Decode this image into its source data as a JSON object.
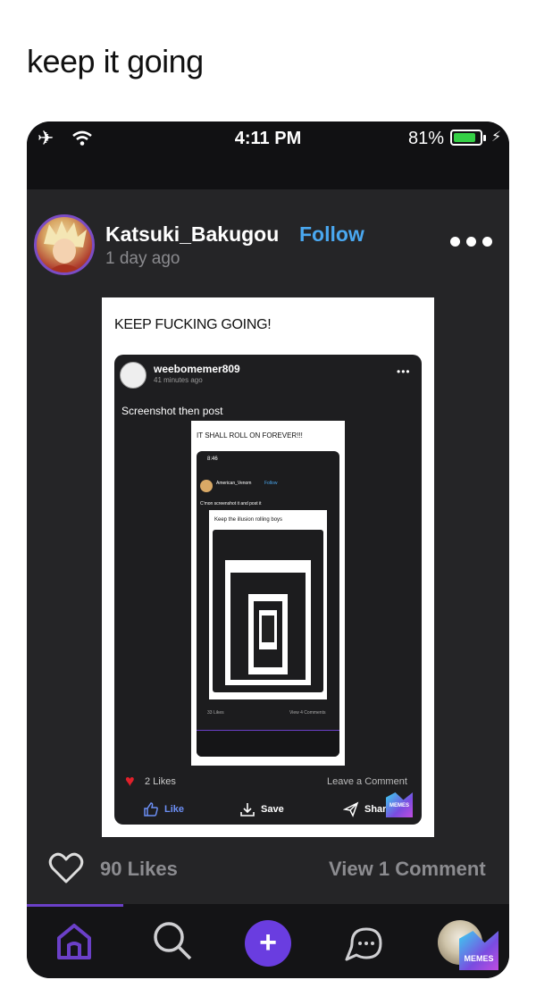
{
  "caption": "keep it going",
  "status_bar": {
    "time": "4:11 PM",
    "battery": "81%"
  },
  "post": {
    "username": "Katsuki_Bakugou",
    "follow_label": "Follow",
    "time_ago": "1 day ago",
    "image_title": "KEEP FUCKING GOING!"
  },
  "embedded_post": {
    "username": "weebomemer809",
    "time_ago": "41 minutes ago",
    "text": "Screenshot then post",
    "image_title": "IT SHALL ROLL ON FOREVER!!!",
    "likes": "2 Likes",
    "leave_comment": "Leave a Comment",
    "like_label": "Like",
    "save_label": "Save",
    "share_label": "Share",
    "nested": {
      "time": "8:46",
      "username": "American_Venom",
      "follow_label": "Follow",
      "text": "C'mon screenshot it and post it",
      "image_title": "Keep the illusion rolling boys",
      "likes": "33 Likes",
      "comments": "View 4 Comments"
    }
  },
  "footer": {
    "likes": "90 Likes",
    "comments": "View 1 Comment"
  },
  "watermark": "MEMES",
  "icons": [
    "airplane-icon",
    "wifi-icon",
    "battery-icon",
    "heart-icon",
    "home-icon",
    "search-icon",
    "plus-icon",
    "chat-icon"
  ],
  "colors": {
    "accent": "#6b40c8",
    "follow": "#4aa8f0",
    "like_red": "#e0202a",
    "battery_green": "#35d046"
  }
}
